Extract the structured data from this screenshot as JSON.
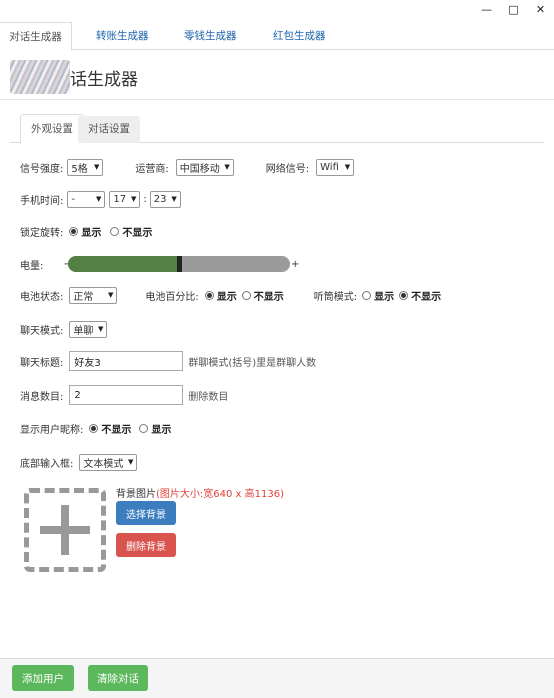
{
  "window": {
    "min_icon": "minimize-icon",
    "max_icon": "maximize-icon",
    "close_icon": "close-icon"
  },
  "top_tabs": [
    "对话生成器",
    "转账生成器",
    "零钱生成器",
    "红包生成器"
  ],
  "header": {
    "title": "话生成器"
  },
  "sub_tabs": [
    "外观设置",
    "对话设置"
  ],
  "form": {
    "signal_label": "信号强度:",
    "signal_value": "5格",
    "carrier_label": "运营商:",
    "carrier_value": "中国移动",
    "network_label": "网络信号:",
    "network_value": "Wifi",
    "time_label": "手机时间:",
    "time_ampm": "-",
    "time_hour": "17",
    "time_sep": ":",
    "time_min": "23",
    "rotation_label": "锁定旋转:",
    "show": "显示",
    "hide": "不显示",
    "battery_label": "电量:",
    "battery_minus": "−",
    "battery_plus": "+",
    "battery_level_pct": 50,
    "battery_state_label": "电池状态:",
    "battery_state_value": "正常",
    "battery_percent_label": "电池百分比:",
    "earpiece_label": "听筒模式:",
    "chat_mode_label": "聊天模式:",
    "chat_mode_value": "单聊",
    "chat_title_label": "聊天标题:",
    "chat_title_value": "好友3",
    "chat_title_hint": "群聊模式(括号)里是群聊人数",
    "msg_count_label": "消息数目:",
    "msg_count_value": "2",
    "msg_count_hint": "删除数目",
    "nickname_label": "显示用户昵称:",
    "input_bar_label": "底部输入框:",
    "input_bar_value": "文本模式"
  },
  "background": {
    "label": "背景图片",
    "size_hint": "(图片大小:宽640 x 高1136)",
    "select_button": "选择背景",
    "delete_button": "删除背景"
  },
  "footer": {
    "add_user": "添加用户",
    "clear_chat": "清除对话"
  },
  "colors": {
    "slider_fill": "#558043",
    "blue_button": "#3c7dbf",
    "red_button": "#d9534f",
    "green_button": "#5cb85c",
    "hint_red": "#e0413a"
  }
}
